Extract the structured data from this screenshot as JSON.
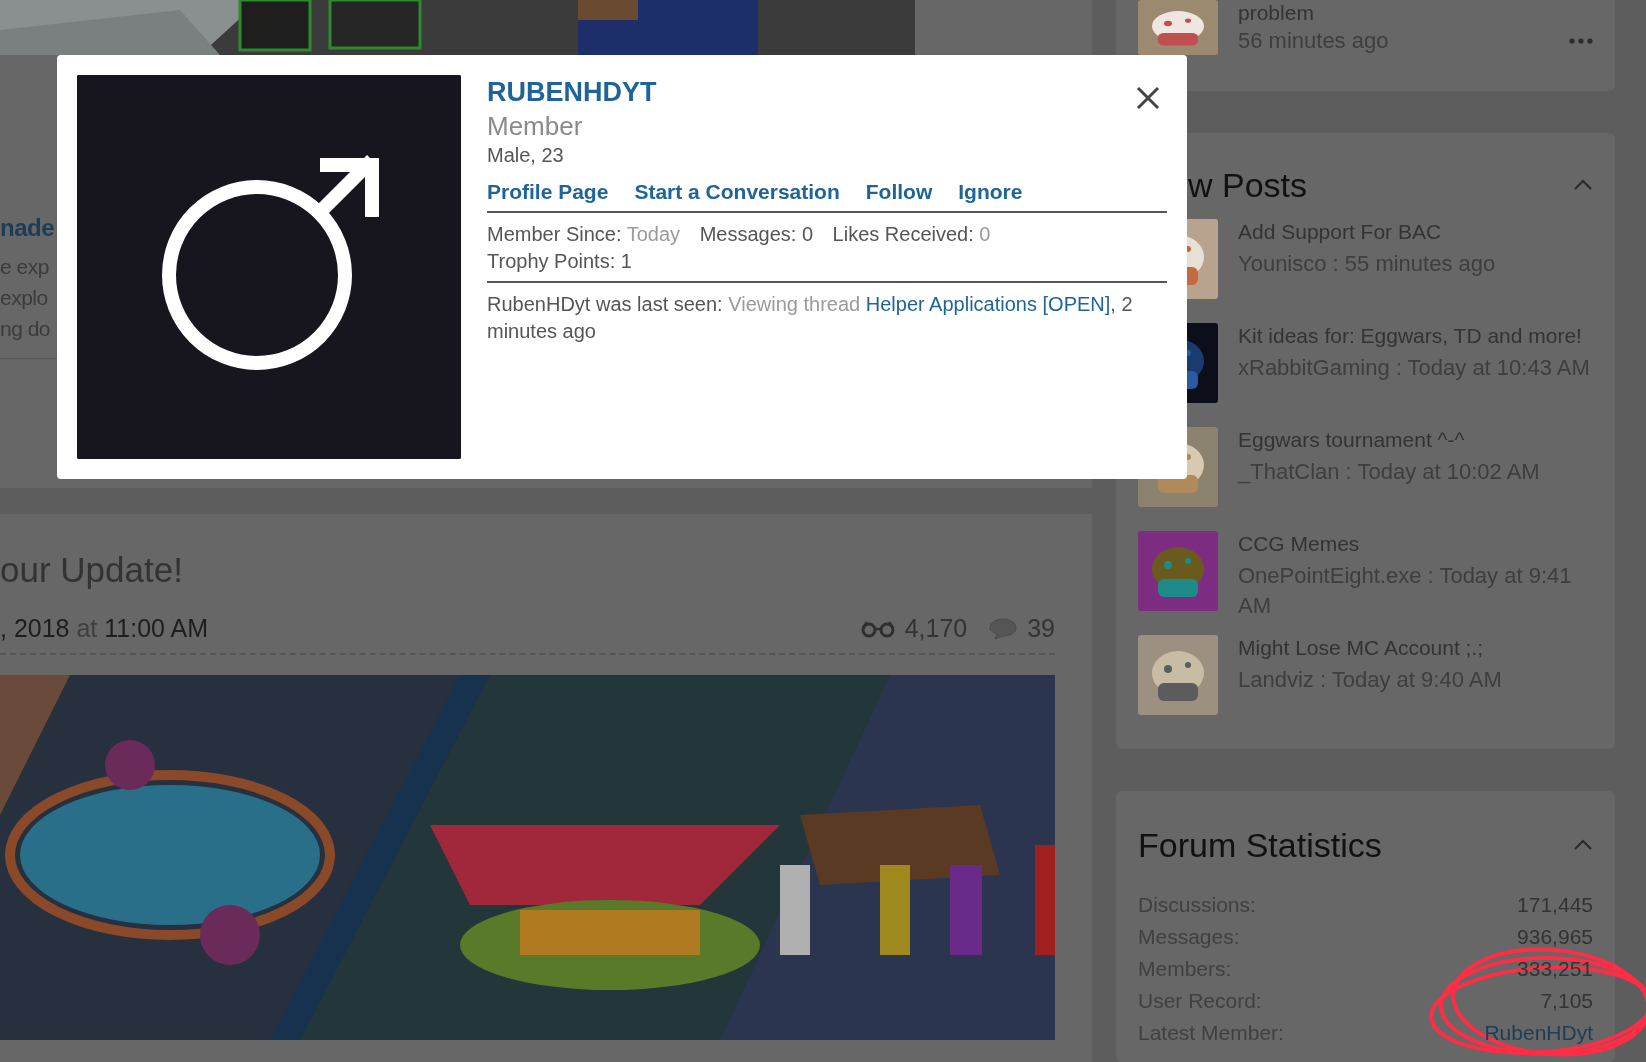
{
  "background_post": {
    "title_fragment": "nade",
    "excerpt_lines": [
      "e exp",
      "explo",
      "ng do"
    ]
  },
  "article": {
    "title": "our Update!",
    "date": ", 2018",
    "at": "at",
    "time": "11:00 AM",
    "views": "4,170",
    "replies": "39"
  },
  "sidebar": {
    "profile_post": {
      "text": "problem",
      "time": "56 minutes ago"
    },
    "new_posts": {
      "title": "w Posts",
      "expanded": true,
      "items": [
        {
          "title": "Add Support For BAC",
          "meta": "Younisco : 55 minutes ago"
        },
        {
          "title": "Kit ideas for: Eggwars, TD and more!",
          "meta": "xRabbitGaming : Today at 10:43 AM"
        },
        {
          "title": "Eggwars tournament ^-^",
          "meta": "_ThatClan : Today at 10:02 AM"
        },
        {
          "title": "CCG Memes",
          "meta": "OnePointEight.exe : Today at 9:41 AM"
        },
        {
          "title": "Might Lose MC Account ;.;",
          "meta": "Landviz : Today at 9:40 AM"
        }
      ]
    },
    "forum_statistics": {
      "title": "Forum Statistics",
      "expanded": true,
      "rows": [
        {
          "label": "Discussions:",
          "value": "171,445",
          "kind": "text"
        },
        {
          "label": "Messages:",
          "value": "936,965",
          "kind": "text"
        },
        {
          "label": "Members:",
          "value": "333,251",
          "kind": "text"
        },
        {
          "label": "User Record:",
          "value": "7,105",
          "kind": "text"
        },
        {
          "label": "Latest Member:",
          "value": "RubenHDyt",
          "kind": "link"
        }
      ]
    }
  },
  "member_card": {
    "name": "RUBENHDYT",
    "title": "Member",
    "info": "Male, 23",
    "links": [
      "Profile Page",
      "Start a Conversation",
      "Follow",
      "Ignore"
    ],
    "stats": [
      {
        "label": "Member Since:",
        "value": "Today",
        "muted": true
      },
      {
        "label": "Messages:",
        "value": "0",
        "muted": false
      },
      {
        "label": "Likes Received:",
        "value": "0",
        "muted": true
      },
      {
        "label": "Trophy Points:",
        "value": "1",
        "muted": false
      }
    ],
    "last_seen": {
      "who": "RubenHDyt was last seen:",
      "activity": "Viewing thread",
      "link": "Helper Applications [OPEN]",
      "when": ", 2 minutes ago"
    }
  }
}
